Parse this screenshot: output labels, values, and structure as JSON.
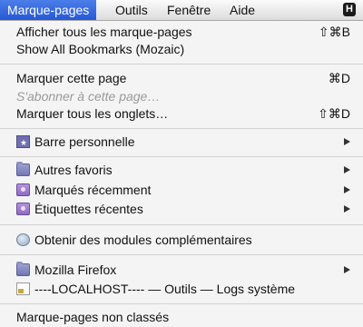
{
  "menubar": {
    "items": [
      {
        "label": "Marque-pages",
        "active": true
      },
      {
        "label": "Outils"
      },
      {
        "label": "Fenêtre"
      },
      {
        "label": "Aide"
      }
    ],
    "status_icon_label": "H"
  },
  "menu": {
    "show_bookmarks": {
      "label": "Afficher tous les marque-pages",
      "shortcut": "⇧⌘B"
    },
    "show_all_mozaic": {
      "label": "Show All Bookmarks (Mozaic)"
    },
    "bookmark_page": {
      "label": "Marquer cette page",
      "shortcut": "⌘D"
    },
    "subscribe_page": {
      "label": "S'abonner à cette page…",
      "disabled": true
    },
    "bookmark_all_tabs": {
      "label": "Marquer tous les onglets…",
      "shortcut": "⇧⌘D"
    },
    "personal_toolbar": {
      "label": "Barre personnelle",
      "icon": "bookmark-toolbar-icon",
      "submenu": true
    },
    "other_bookmarks": {
      "label": "Autres favoris",
      "icon": "folder-icon",
      "submenu": true
    },
    "recently_bookmarked": {
      "label": "Marqués récemment",
      "icon": "smart-folder-icon",
      "submenu": true
    },
    "recent_tags": {
      "label": "Étiquettes récentes",
      "icon": "smart-folder-icon",
      "submenu": true
    },
    "get_addons": {
      "label": "Obtenir des modules complémentaires",
      "icon": "addons-icon"
    },
    "mozilla_firefox": {
      "label": "Mozilla Firefox",
      "icon": "folder-icon",
      "submenu": true
    },
    "localhost": {
      "label": "----LOCALHOST---- — Outils — Logs système",
      "icon": "page-icon"
    },
    "unsorted": {
      "label": "Marque-pages non classés"
    }
  }
}
